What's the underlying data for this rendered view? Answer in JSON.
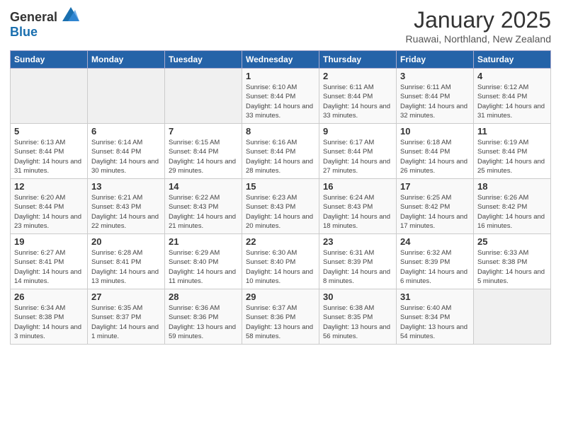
{
  "logo": {
    "general": "General",
    "blue": "Blue"
  },
  "title": {
    "month_year": "January 2025",
    "location": "Ruawai, Northland, New Zealand"
  },
  "weekdays": [
    "Sunday",
    "Monday",
    "Tuesday",
    "Wednesday",
    "Thursday",
    "Friday",
    "Saturday"
  ],
  "weeks": [
    [
      {
        "day": "",
        "sunrise": "",
        "sunset": "",
        "daylight": ""
      },
      {
        "day": "",
        "sunrise": "",
        "sunset": "",
        "daylight": ""
      },
      {
        "day": "",
        "sunrise": "",
        "sunset": "",
        "daylight": ""
      },
      {
        "day": "1",
        "sunrise": "6:10 AM",
        "sunset": "8:44 PM",
        "daylight": "14 hours and 33 minutes."
      },
      {
        "day": "2",
        "sunrise": "6:11 AM",
        "sunset": "8:44 PM",
        "daylight": "14 hours and 33 minutes."
      },
      {
        "day": "3",
        "sunrise": "6:11 AM",
        "sunset": "8:44 PM",
        "daylight": "14 hours and 32 minutes."
      },
      {
        "day": "4",
        "sunrise": "6:12 AM",
        "sunset": "8:44 PM",
        "daylight": "14 hours and 31 minutes."
      }
    ],
    [
      {
        "day": "5",
        "sunrise": "6:13 AM",
        "sunset": "8:44 PM",
        "daylight": "14 hours and 31 minutes."
      },
      {
        "day": "6",
        "sunrise": "6:14 AM",
        "sunset": "8:44 PM",
        "daylight": "14 hours and 30 minutes."
      },
      {
        "day": "7",
        "sunrise": "6:15 AM",
        "sunset": "8:44 PM",
        "daylight": "14 hours and 29 minutes."
      },
      {
        "day": "8",
        "sunrise": "6:16 AM",
        "sunset": "8:44 PM",
        "daylight": "14 hours and 28 minutes."
      },
      {
        "day": "9",
        "sunrise": "6:17 AM",
        "sunset": "8:44 PM",
        "daylight": "14 hours and 27 minutes."
      },
      {
        "day": "10",
        "sunrise": "6:18 AM",
        "sunset": "8:44 PM",
        "daylight": "14 hours and 26 minutes."
      },
      {
        "day": "11",
        "sunrise": "6:19 AM",
        "sunset": "8:44 PM",
        "daylight": "14 hours and 25 minutes."
      }
    ],
    [
      {
        "day": "12",
        "sunrise": "6:20 AM",
        "sunset": "8:44 PM",
        "daylight": "14 hours and 23 minutes."
      },
      {
        "day": "13",
        "sunrise": "6:21 AM",
        "sunset": "8:43 PM",
        "daylight": "14 hours and 22 minutes."
      },
      {
        "day": "14",
        "sunrise": "6:22 AM",
        "sunset": "8:43 PM",
        "daylight": "14 hours and 21 minutes."
      },
      {
        "day": "15",
        "sunrise": "6:23 AM",
        "sunset": "8:43 PM",
        "daylight": "14 hours and 20 minutes."
      },
      {
        "day": "16",
        "sunrise": "6:24 AM",
        "sunset": "8:43 PM",
        "daylight": "14 hours and 18 minutes."
      },
      {
        "day": "17",
        "sunrise": "6:25 AM",
        "sunset": "8:42 PM",
        "daylight": "14 hours and 17 minutes."
      },
      {
        "day": "18",
        "sunrise": "6:26 AM",
        "sunset": "8:42 PM",
        "daylight": "14 hours and 16 minutes."
      }
    ],
    [
      {
        "day": "19",
        "sunrise": "6:27 AM",
        "sunset": "8:41 PM",
        "daylight": "14 hours and 14 minutes."
      },
      {
        "day": "20",
        "sunrise": "6:28 AM",
        "sunset": "8:41 PM",
        "daylight": "14 hours and 13 minutes."
      },
      {
        "day": "21",
        "sunrise": "6:29 AM",
        "sunset": "8:40 PM",
        "daylight": "14 hours and 11 minutes."
      },
      {
        "day": "22",
        "sunrise": "6:30 AM",
        "sunset": "8:40 PM",
        "daylight": "14 hours and 10 minutes."
      },
      {
        "day": "23",
        "sunrise": "6:31 AM",
        "sunset": "8:39 PM",
        "daylight": "14 hours and 8 minutes."
      },
      {
        "day": "24",
        "sunrise": "6:32 AM",
        "sunset": "8:39 PM",
        "daylight": "14 hours and 6 minutes."
      },
      {
        "day": "25",
        "sunrise": "6:33 AM",
        "sunset": "8:38 PM",
        "daylight": "14 hours and 5 minutes."
      }
    ],
    [
      {
        "day": "26",
        "sunrise": "6:34 AM",
        "sunset": "8:38 PM",
        "daylight": "14 hours and 3 minutes."
      },
      {
        "day": "27",
        "sunrise": "6:35 AM",
        "sunset": "8:37 PM",
        "daylight": "14 hours and 1 minute."
      },
      {
        "day": "28",
        "sunrise": "6:36 AM",
        "sunset": "8:36 PM",
        "daylight": "13 hours and 59 minutes."
      },
      {
        "day": "29",
        "sunrise": "6:37 AM",
        "sunset": "8:36 PM",
        "daylight": "13 hours and 58 minutes."
      },
      {
        "day": "30",
        "sunrise": "6:38 AM",
        "sunset": "8:35 PM",
        "daylight": "13 hours and 56 minutes."
      },
      {
        "day": "31",
        "sunrise": "6:40 AM",
        "sunset": "8:34 PM",
        "daylight": "13 hours and 54 minutes."
      },
      {
        "day": "",
        "sunrise": "",
        "sunset": "",
        "daylight": ""
      }
    ]
  ]
}
